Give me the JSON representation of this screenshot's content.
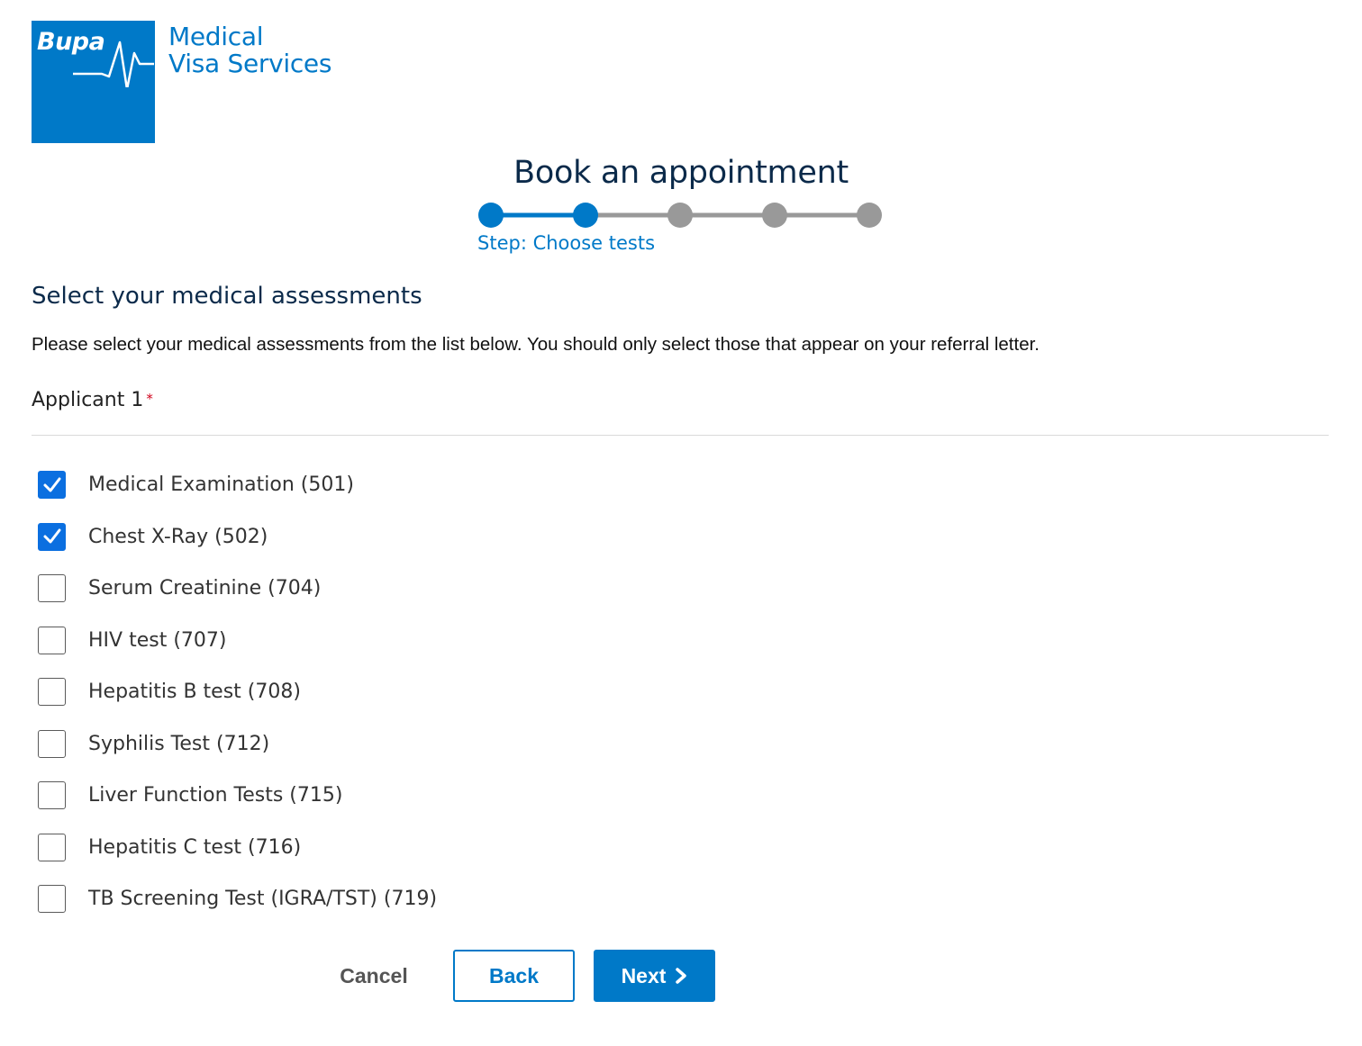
{
  "brand": {
    "logo_text": "Bupa",
    "name_line1": "Medical",
    "name_line2": "Visa Services",
    "logo_color": "#0079c8"
  },
  "header": {
    "title": "Book an appointment"
  },
  "stepper": {
    "total_steps": 5,
    "current_step": 2,
    "step_label": "Step: Choose tests",
    "active_color": "#0079c8",
    "inactive_color": "#999999"
  },
  "section": {
    "title": "Select your medical assessments",
    "instructions": "Please select your medical assessments from the list below. You should only select those that appear on your referral letter.",
    "applicant_label": "Applicant 1",
    "required_marker": "*"
  },
  "tests": [
    {
      "label": "Medical Examination (501)",
      "checked": true
    },
    {
      "label": "Chest X-Ray (502)",
      "checked": true
    },
    {
      "label": "Serum Creatinine (704)",
      "checked": false
    },
    {
      "label": "HIV test (707)",
      "checked": false
    },
    {
      "label": "Hepatitis B test (708)",
      "checked": false
    },
    {
      "label": "Syphilis Test (712)",
      "checked": false
    },
    {
      "label": "Liver Function Tests (715)",
      "checked": false
    },
    {
      "label": "Hepatitis C test (716)",
      "checked": false
    },
    {
      "label": "TB Screening Test (IGRA/TST) (719)",
      "checked": false
    }
  ],
  "actions": {
    "cancel_label": "Cancel",
    "back_label": "Back",
    "next_label": "Next",
    "next_icon": "chevron-right-icon"
  }
}
